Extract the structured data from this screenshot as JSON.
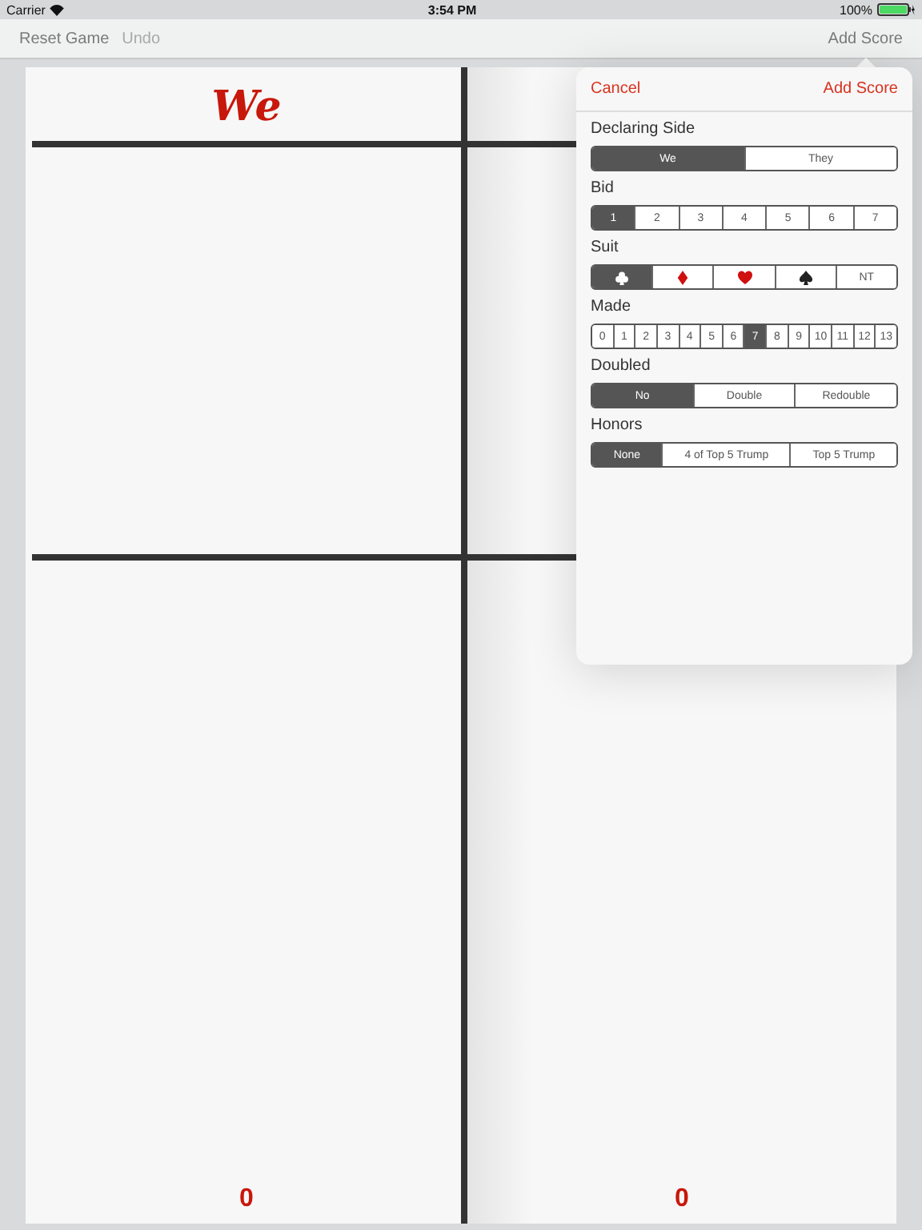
{
  "status_bar": {
    "carrier": "Carrier",
    "time": "3:54 PM",
    "battery": "100%"
  },
  "nav_bar": {
    "left": [
      {
        "label": "Reset Game",
        "disabled": false
      },
      {
        "label": "Undo",
        "disabled": true
      }
    ],
    "right": {
      "label": "Add Score",
      "disabled": false
    }
  },
  "score_pad": {
    "headers": [
      "We"
    ],
    "totals": [
      "0",
      "0"
    ]
  },
  "popover": {
    "cancel": "Cancel",
    "confirm": "Add Score",
    "sections": [
      {
        "label": "Declaring Side",
        "options": [
          {
            "kind": "text",
            "label": "We",
            "selected": true
          },
          {
            "kind": "text",
            "label": "They",
            "selected": false
          }
        ]
      },
      {
        "label": "Bid",
        "options": [
          {
            "kind": "text",
            "label": "1",
            "selected": true
          },
          {
            "kind": "text",
            "label": "2",
            "selected": false
          },
          {
            "kind": "text",
            "label": "3",
            "selected": false
          },
          {
            "kind": "text",
            "label": "4",
            "selected": false
          },
          {
            "kind": "text",
            "label": "5",
            "selected": false
          },
          {
            "kind": "text",
            "label": "6",
            "selected": false
          },
          {
            "kind": "text",
            "label": "7",
            "selected": false
          }
        ]
      },
      {
        "label": "Suit",
        "options": [
          {
            "kind": "club",
            "selected": true
          },
          {
            "kind": "diamond",
            "selected": false
          },
          {
            "kind": "heart",
            "selected": false
          },
          {
            "kind": "spade",
            "selected": false
          },
          {
            "kind": "text",
            "label": "NT",
            "selected": false
          }
        ]
      },
      {
        "label": "Made",
        "options": [
          {
            "kind": "text",
            "label": "0",
            "selected": false
          },
          {
            "kind": "text",
            "label": "1",
            "selected": false
          },
          {
            "kind": "text",
            "label": "2",
            "selected": false
          },
          {
            "kind": "text",
            "label": "3",
            "selected": false
          },
          {
            "kind": "text",
            "label": "4",
            "selected": false
          },
          {
            "kind": "text",
            "label": "5",
            "selected": false
          },
          {
            "kind": "text",
            "label": "6",
            "selected": false
          },
          {
            "kind": "text",
            "label": "7",
            "selected": true
          },
          {
            "kind": "text",
            "label": "8",
            "selected": false
          },
          {
            "kind": "text",
            "label": "9",
            "selected": false
          },
          {
            "kind": "text",
            "label": "10",
            "selected": false
          },
          {
            "kind": "text",
            "label": "11",
            "selected": false
          },
          {
            "kind": "text",
            "label": "12",
            "selected": false
          },
          {
            "kind": "text",
            "label": "13",
            "selected": false
          }
        ]
      },
      {
        "label": "Doubled",
        "options": [
          {
            "kind": "text",
            "label": "No",
            "selected": true
          },
          {
            "kind": "text",
            "label": "Double",
            "selected": false
          },
          {
            "kind": "text",
            "label": "Redouble",
            "selected": false
          }
        ]
      },
      {
        "label": "Honors",
        "options": [
          {
            "kind": "text",
            "label": "None",
            "selected": true
          },
          {
            "kind": "text",
            "label": "4 of Top 5 Trump",
            "selected": false
          },
          {
            "kind": "text",
            "label": "Top 5 Trump",
            "selected": false
          }
        ]
      }
    ]
  }
}
